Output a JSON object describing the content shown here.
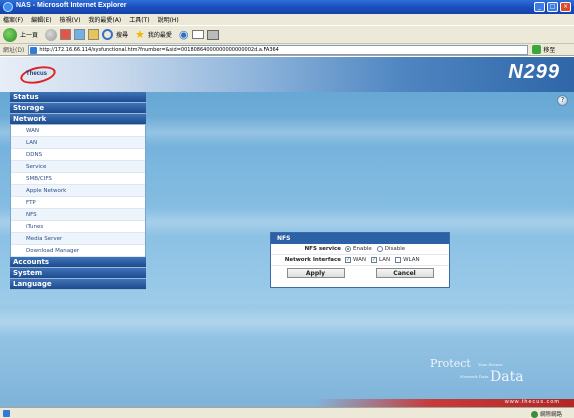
{
  "window": {
    "title": "NAS - Microsoft Internet Explorer",
    "min": "_",
    "max": "□",
    "close": "×"
  },
  "menubar": [
    "檔案(F)",
    "編輯(E)",
    "檢視(V)",
    "我的最愛(A)",
    "工具(T)",
    "說明(H)"
  ],
  "toolbar": {
    "back_label": "上一頁",
    "search_label": "搜尋",
    "favorites_label": "我的最愛"
  },
  "addressbar": {
    "label": "網址(D)",
    "url": "http://172.16.66.114/sysfunctional.htm?fnumber=&sid=00180864000000000000002d.a.FA364",
    "go_label": "移至"
  },
  "banner": {
    "logo_text": "Thecus",
    "model": "N299"
  },
  "sidebar": {
    "status": "Status",
    "storage": "Storage",
    "network": "Network",
    "network_items": [
      "WAN",
      "LAN",
      "DDNS",
      "Service",
      "SMB/CIFS",
      "Apple Network",
      "FTP",
      "NFS",
      "iTunes",
      "Media Server",
      "Download Manager"
    ],
    "accounts": "Accounts",
    "system": "System",
    "language": "Language"
  },
  "nfs_dialog": {
    "title": "NFS",
    "service_label": "NFS service",
    "enable_label": "Enable",
    "disable_label": "Disable",
    "interface_label": "Network Interface",
    "wan_label": "WAN",
    "lan_label": "LAN",
    "wlan_label": "WLAN",
    "apply_label": "Apply",
    "cancel_label": "Cancel"
  },
  "tagline": {
    "protect": "Protect",
    "protect_small": "Your Secure",
    "data_small": "Network Data",
    "data": "Data"
  },
  "website": "www.thecus.com",
  "statusbar": {
    "zone": "網際網路"
  },
  "colors": {
    "sidebar_header": "#1d4b8e",
    "dialog_title": "#2c61a6",
    "page_bg": "#7ab6de"
  }
}
